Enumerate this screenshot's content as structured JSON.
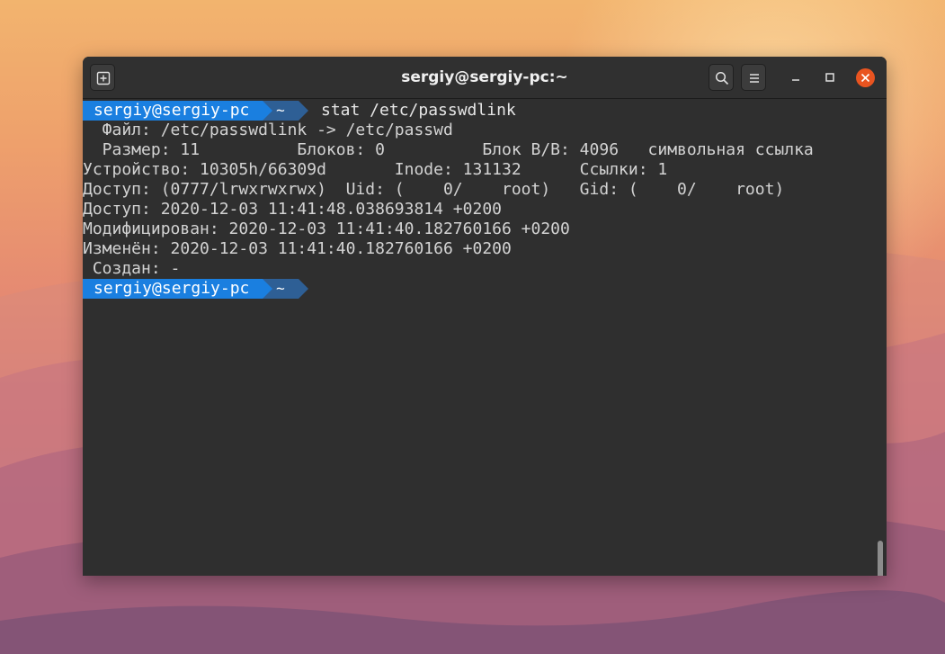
{
  "window": {
    "title": "sergiy@sergiy-pc:~",
    "buttons": {
      "new_tab_icon": "new-tab-icon",
      "search_icon": "search-icon",
      "menu_icon": "hamburger-menu-icon",
      "minimize_icon": "minimize-icon",
      "maximize_icon": "maximize-icon",
      "close_icon": "close-icon"
    },
    "colors": {
      "prompt_user_bg": "#1a7fe0",
      "prompt_dir_bg": "#2e5f95",
      "close_bg": "#e95420",
      "terminal_bg": "#2f2f2f"
    }
  },
  "prompt": {
    "user_host": "sergiy@sergiy-pc",
    "dir": "~"
  },
  "command": "stat /etc/passwdlink",
  "output": [
    "  Файл: /etc/passwdlink -> /etc/passwd",
    "  Размер: 11          Блоков: 0          Блок В/В: 4096   символьная ссылка",
    "Устройство: 10305h/66309d       Inode: 131132      Ссылки: 1",
    "Доступ: (0777/lrwxrwxrwx)  Uid: (    0/    root)   Gid: (    0/    root)",
    "Доступ: 2020-12-03 11:41:48.038693814 +0200",
    "Модифицирован: 2020-12-03 11:41:40.182760166 +0200",
    "Изменён: 2020-12-03 11:41:40.182760166 +0200",
    " Создан: -"
  ]
}
